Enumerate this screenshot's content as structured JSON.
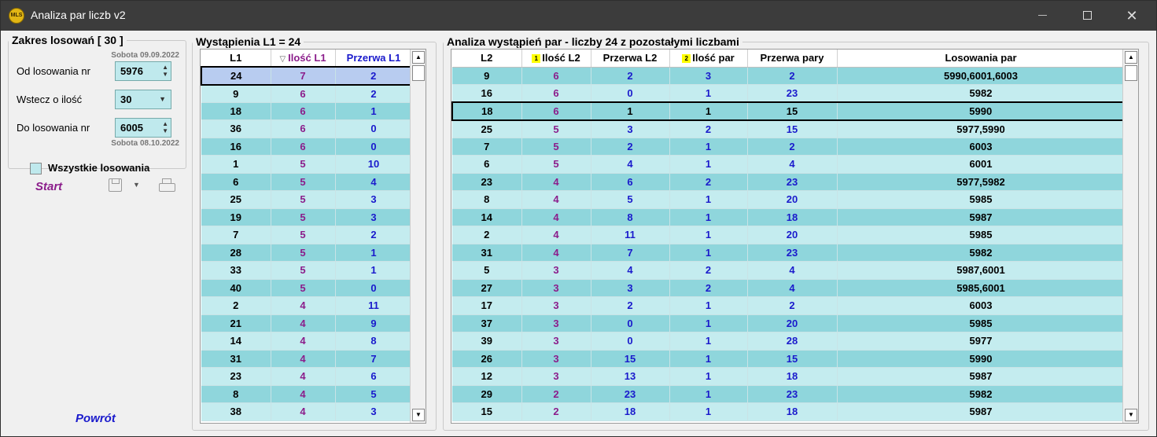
{
  "window": {
    "title": "Analiza par liczb v2",
    "icon_text": "MLS"
  },
  "zakres": {
    "legend": "Zakres losowań  [ 30 ]",
    "from_date": "Sobota 09.09.2022",
    "od_label": "Od losowania nr",
    "od_value": "5976",
    "wstecz_label": "Wstecz o ilość",
    "wstecz_value": "30",
    "do_label": "Do losowania nr",
    "do_value": "6005",
    "to_date": "Sobota 08.10.2022",
    "all_label": "Wszystkie losowania"
  },
  "actions": {
    "start": "Start",
    "back": "Powrót"
  },
  "l1": {
    "legend": "Wystąpienia L1 = 24",
    "headers": [
      "L1",
      "Ilość L1",
      "Przerwa L1"
    ],
    "rows": [
      [
        "24",
        "7",
        "2"
      ],
      [
        "9",
        "6",
        "2"
      ],
      [
        "18",
        "6",
        "1"
      ],
      [
        "36",
        "6",
        "0"
      ],
      [
        "16",
        "6",
        "0"
      ],
      [
        "1",
        "5",
        "10"
      ],
      [
        "6",
        "5",
        "4"
      ],
      [
        "25",
        "5",
        "3"
      ],
      [
        "19",
        "5",
        "3"
      ],
      [
        "7",
        "5",
        "2"
      ],
      [
        "28",
        "5",
        "1"
      ],
      [
        "33",
        "5",
        "1"
      ],
      [
        "40",
        "5",
        "0"
      ],
      [
        "2",
        "4",
        "11"
      ],
      [
        "21",
        "4",
        "9"
      ],
      [
        "14",
        "4",
        "8"
      ],
      [
        "31",
        "4",
        "7"
      ],
      [
        "23",
        "4",
        "6"
      ],
      [
        "8",
        "4",
        "5"
      ],
      [
        "38",
        "4",
        "3"
      ]
    ]
  },
  "pairs": {
    "legend": "Analiza wystąpień par - liczby 24 z pozostałymi liczbami",
    "headers": [
      "L2",
      "Ilość L2",
      "Przerwa L2",
      "Ilość par",
      "Przerwa pary",
      "Losowania par"
    ],
    "badges": [
      "1",
      "2"
    ],
    "rows": [
      [
        "9",
        "6",
        "2",
        "3",
        "2",
        "5990,6001,6003"
      ],
      [
        "16",
        "6",
        "0",
        "1",
        "23",
        "5982"
      ],
      [
        "18",
        "6",
        "1",
        "1",
        "15",
        "5990"
      ],
      [
        "25",
        "5",
        "3",
        "2",
        "15",
        "5977,5990"
      ],
      [
        "7",
        "5",
        "2",
        "1",
        "2",
        "6003"
      ],
      [
        "6",
        "5",
        "4",
        "1",
        "4",
        "6001"
      ],
      [
        "23",
        "4",
        "6",
        "2",
        "23",
        "5977,5982"
      ],
      [
        "8",
        "4",
        "5",
        "1",
        "20",
        "5985"
      ],
      [
        "14",
        "4",
        "8",
        "1",
        "18",
        "5987"
      ],
      [
        "2",
        "4",
        "11",
        "1",
        "20",
        "5985"
      ],
      [
        "31",
        "4",
        "7",
        "1",
        "23",
        "5982"
      ],
      [
        "5",
        "3",
        "4",
        "2",
        "4",
        "5987,6001"
      ],
      [
        "27",
        "3",
        "3",
        "2",
        "4",
        "5985,6001"
      ],
      [
        "17",
        "3",
        "2",
        "1",
        "2",
        "6003"
      ],
      [
        "37",
        "3",
        "0",
        "1",
        "20",
        "5985"
      ],
      [
        "39",
        "3",
        "0",
        "1",
        "28",
        "5977"
      ],
      [
        "26",
        "3",
        "15",
        "1",
        "15",
        "5990"
      ],
      [
        "12",
        "3",
        "13",
        "1",
        "18",
        "5987"
      ],
      [
        "29",
        "2",
        "23",
        "1",
        "23",
        "5982"
      ],
      [
        "15",
        "2",
        "18",
        "1",
        "18",
        "5987"
      ]
    ]
  },
  "colors": {
    "row_dark": "#8fd6dc",
    "row_light": "#c4ecef",
    "selected_row": "#b8ccf0",
    "purple_text": "#8b1d8b",
    "blue_text": "#1a1acc"
  }
}
